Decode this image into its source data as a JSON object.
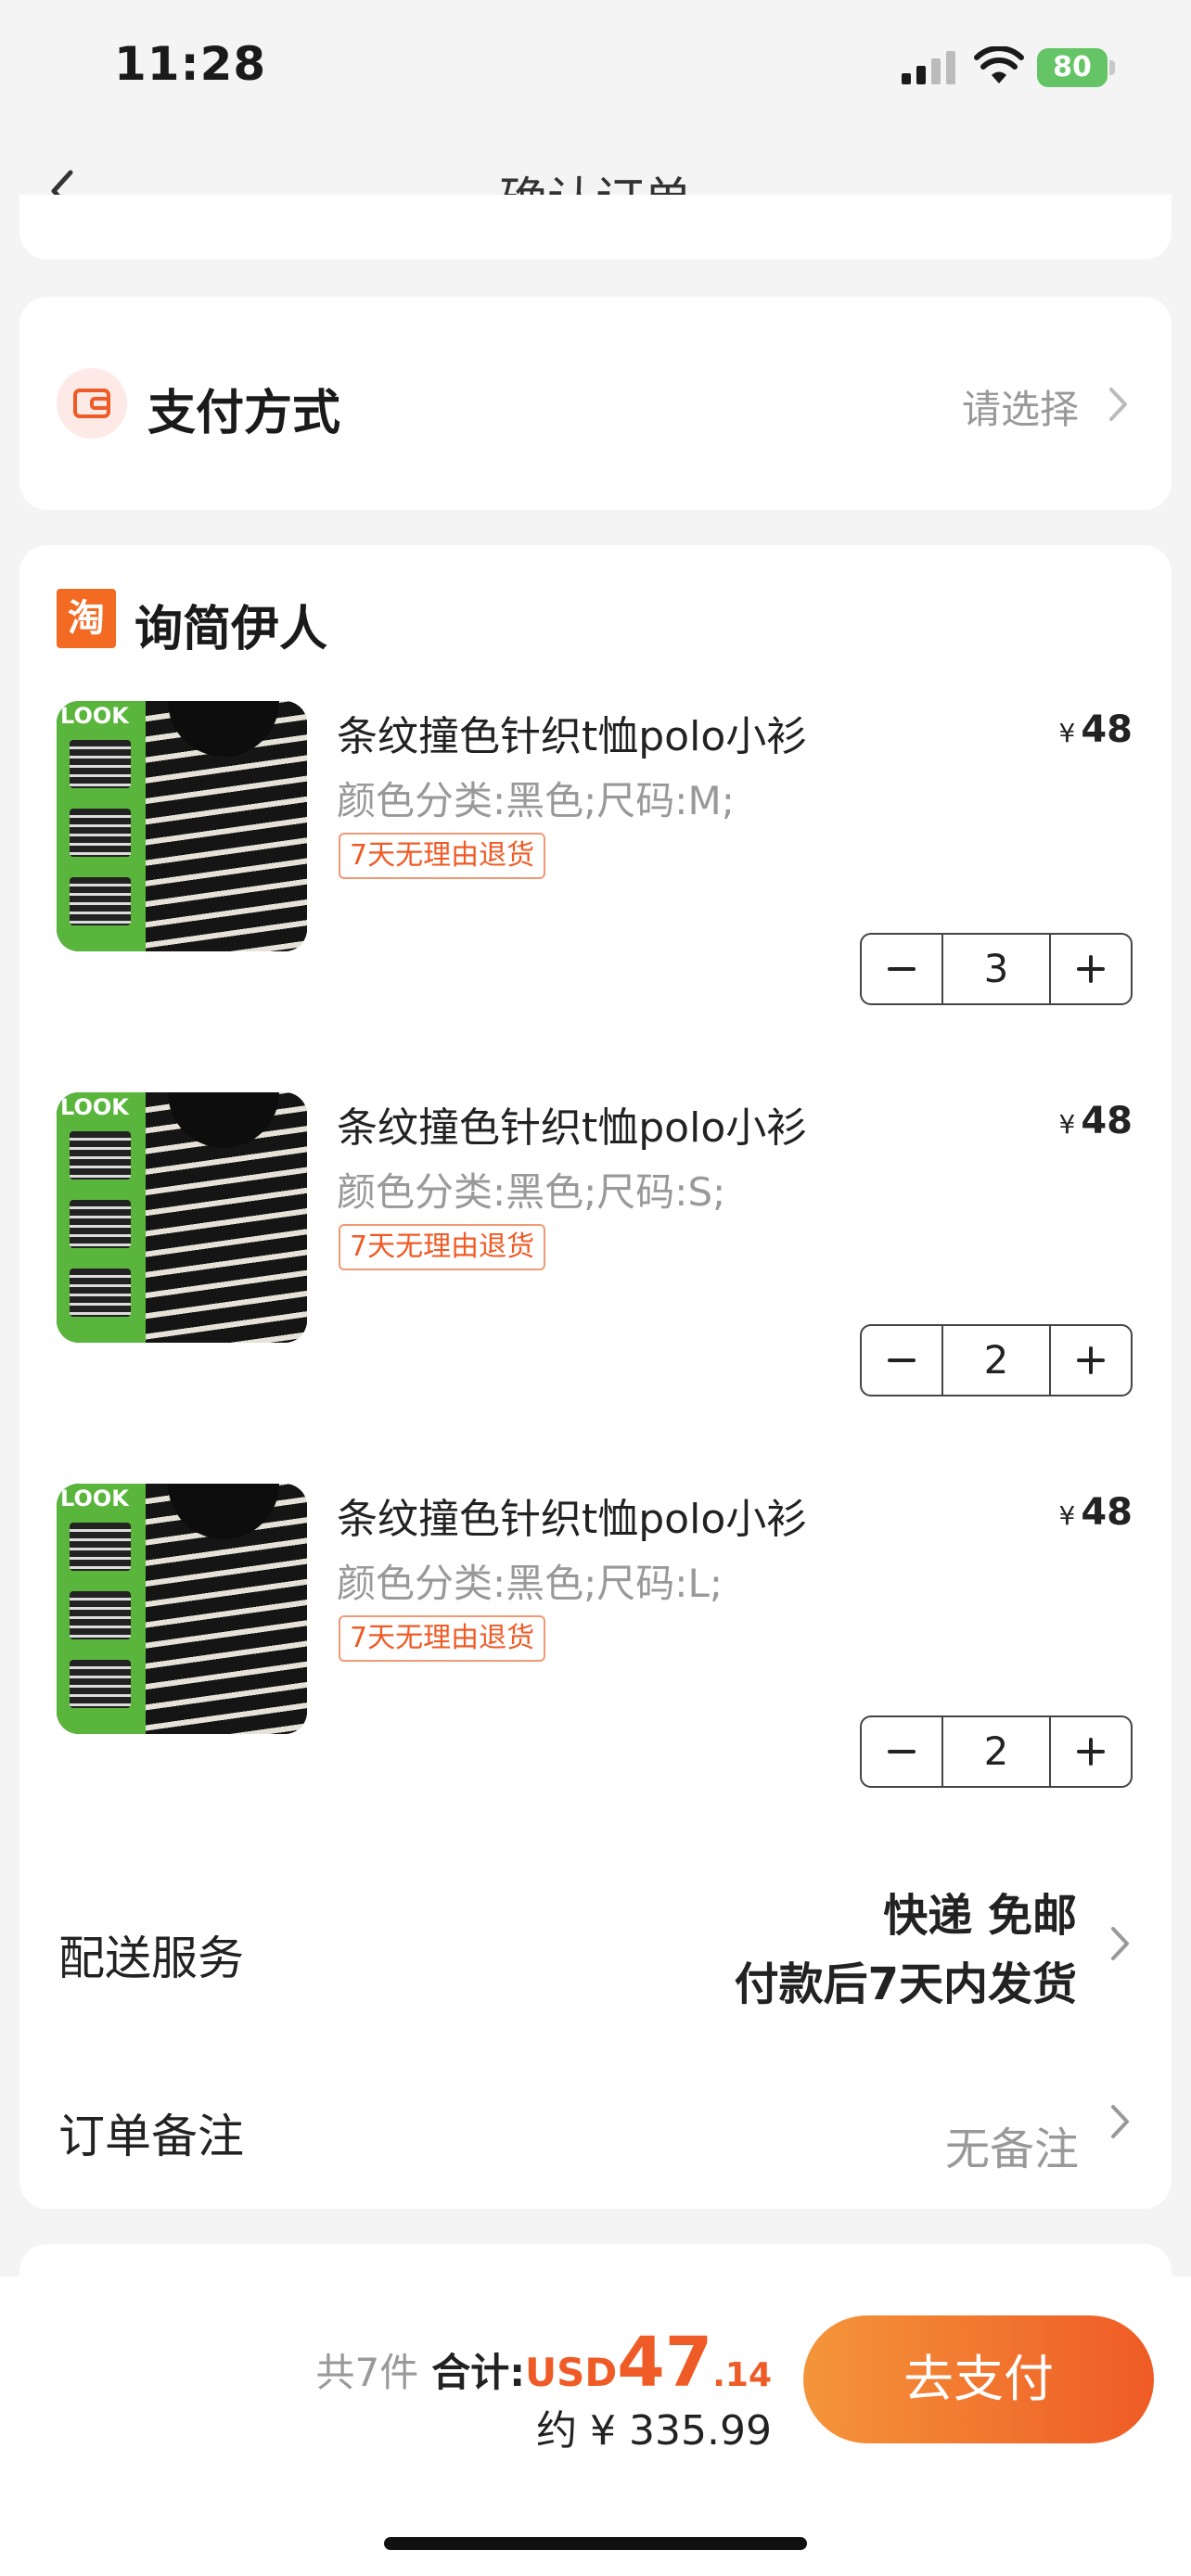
{
  "status_bar": {
    "time": "11:28",
    "battery": "80"
  },
  "nav": {
    "title": "确认订单"
  },
  "payment": {
    "title": "支付方式",
    "value": "请选择"
  },
  "shop": {
    "logo_text": "淘",
    "name": "询简伊人"
  },
  "items": [
    {
      "title": "条纹撞色针织t恤polo小衫",
      "price": "48",
      "currency": "¥",
      "spec": "颜色分类:黑色;尺码:M;",
      "tag": "7天无理由退货",
      "quantity": "3",
      "thumb_label": "LOOK"
    },
    {
      "title": "条纹撞色针织t恤polo小衫",
      "price": "48",
      "currency": "¥",
      "spec": "颜色分类:黑色;尺码:S;",
      "tag": "7天无理由退货",
      "quantity": "2",
      "thumb_label": "LOOK"
    },
    {
      "title": "条纹撞色针织t恤polo小衫",
      "price": "48",
      "currency": "¥",
      "spec": "颜色分类:黑色;尺码:L;",
      "tag": "7天无理由退货",
      "quantity": "2",
      "thumb_label": "LOOK"
    }
  ],
  "delivery": {
    "label": "配送服务",
    "line1": "快递 免邮",
    "line2": "付款后7天内发货"
  },
  "note": {
    "label": "订单备注",
    "value": "无备注"
  },
  "summary": {
    "count": "共7件",
    "total_label": "合计:",
    "currency": "USD",
    "total_int": "47",
    "total_dec": ".14",
    "approx": "约 ¥ 335.99",
    "pay_button": "去支付"
  },
  "colors": {
    "accent": "#ef5b26",
    "accent_light": "#f4953a",
    "muted_text": "#999999",
    "page_background": "#f4f4f4"
  },
  "icons": {
    "back": "chevron-left-icon",
    "payment": "wallet-icon",
    "row_arrow": "chevron-right-icon",
    "minus": "minus-icon",
    "plus": "plus-icon"
  }
}
